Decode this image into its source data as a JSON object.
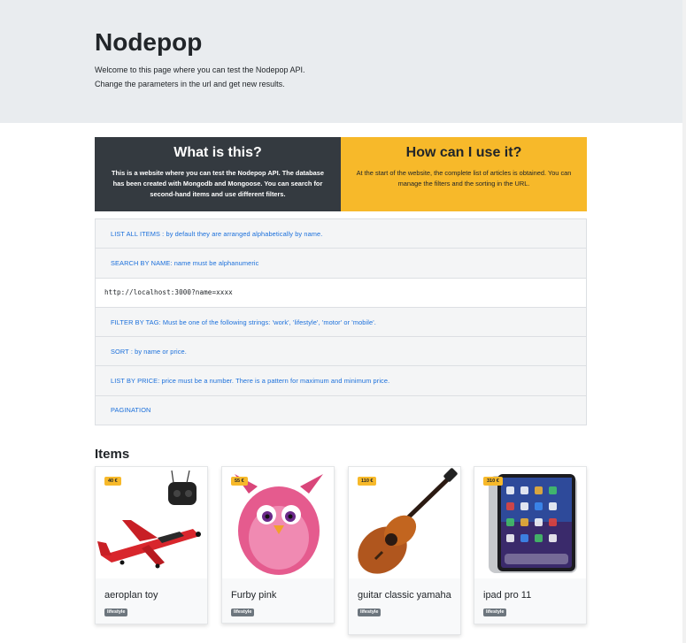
{
  "header": {
    "title": "Nodepop",
    "subtitle_line1": "Welcome to this page where you can test the Nodepop API.",
    "subtitle_line2": "Change the parameters in the url and get new results."
  },
  "info": {
    "what": {
      "title": "What is this?",
      "text": "This is a website where you can test the Nodepop API. The database has been created with Mongodb and Mongoose. You can search for second-hand items and use different filters."
    },
    "how": {
      "title": "How can I use it?",
      "text": "At the start of the website, the complete list of articles is obtained. You can manage the filters and the sorting in the URL."
    }
  },
  "list": {
    "all_items": "LIST ALL ITEMS : by default they are arranged alphabetically by name.",
    "search": "SEARCH BY NAME: name must be alphanumeric",
    "search_example": "http://localhost:3000?name=xxxx",
    "filter": "FILTER BY TAG: Must be one of the following strings: 'work', 'lifestyle', 'motor' or 'mobile'.",
    "sort": "SORT : by name or price.",
    "price": "LIST BY PRICE: price must be a number. There is a pattern for maximum and minimum price.",
    "pagination": "PAGINATION"
  },
  "items_title": "Items",
  "items": [
    {
      "name": "aeroplan toy",
      "price": "40 €",
      "tag": "lifestyle"
    },
    {
      "name": "Furby pink",
      "price": "55 €",
      "tag": "lifestyle"
    },
    {
      "name": "guitar classic yamaha",
      "price": "110 €",
      "tag": "lifestyle"
    },
    {
      "name": "ipad pro 11",
      "price": "310 €",
      "tag": "lifestyle"
    }
  ],
  "colors": {
    "jumbotron": "#e9ecef",
    "dark": "#343a40",
    "accent": "#f7b92a",
    "link": "#1a6fdb",
    "badge": "#6c757d"
  }
}
